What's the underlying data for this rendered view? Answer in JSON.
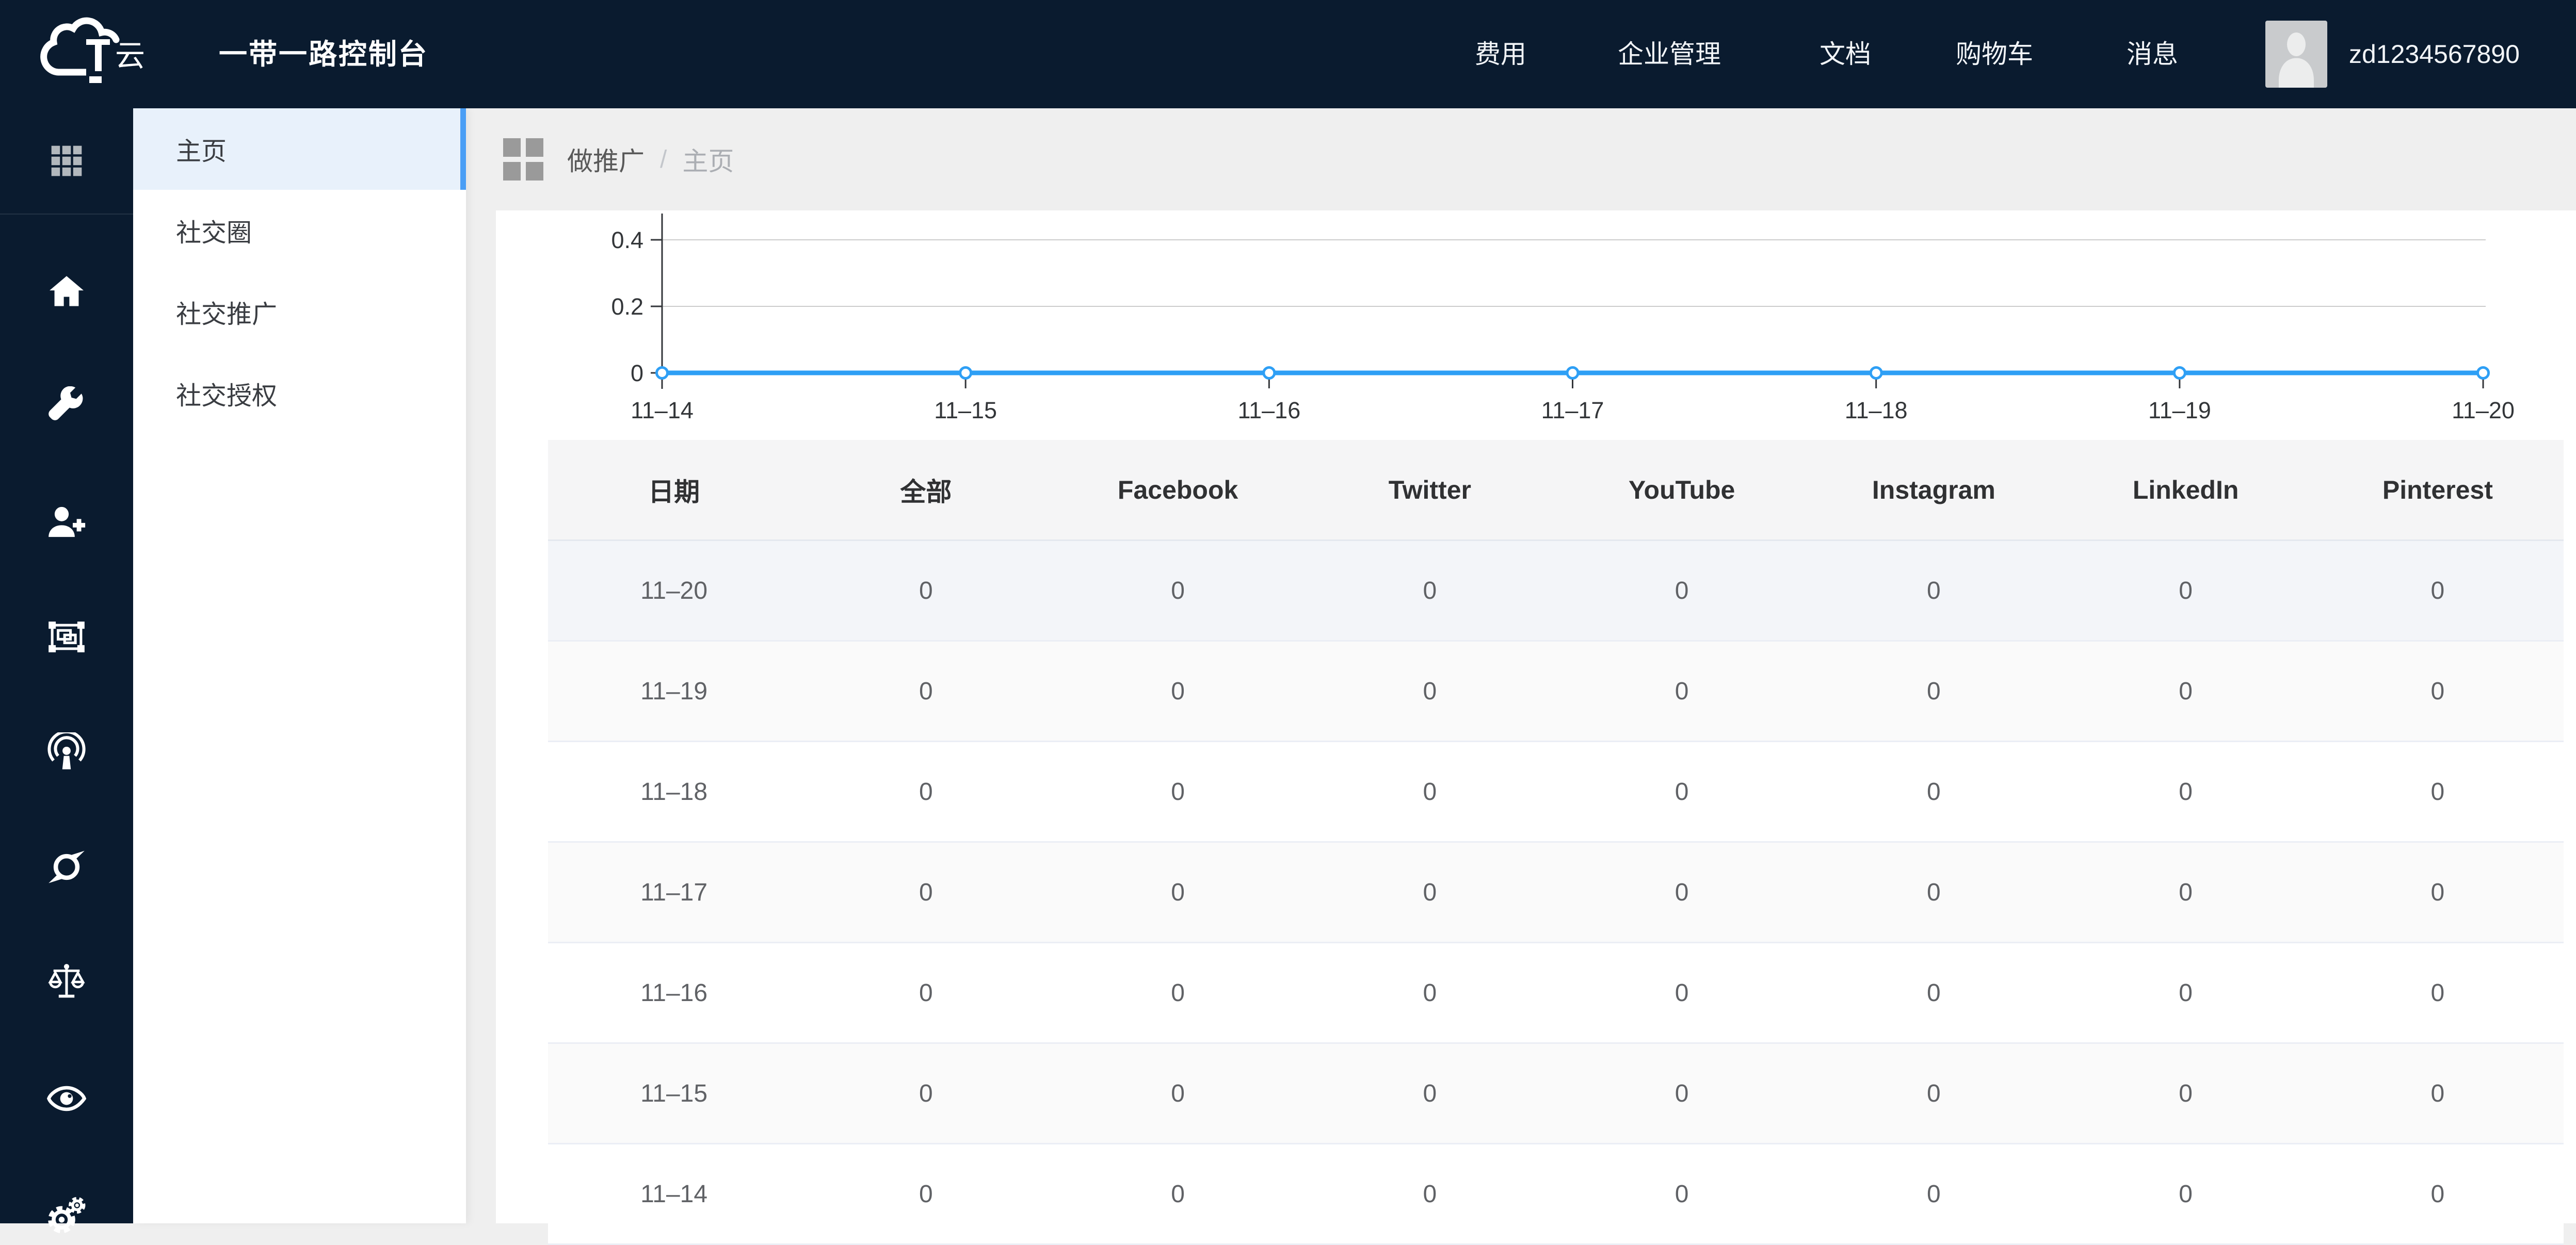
{
  "topbar": {
    "title": "一带一路控制台",
    "logo": {
      "t": "T",
      "yun": "云"
    },
    "nav": [
      {
        "key": "fees",
        "label": "费用"
      },
      {
        "key": "enterprise",
        "label": "企业管理"
      },
      {
        "key": "docs",
        "label": "文档"
      },
      {
        "key": "cart",
        "label": "购物车"
      },
      {
        "key": "messages",
        "label": "消息"
      }
    ],
    "username": "zd1234567890"
  },
  "icon_rail": {
    "top_icon": "grid-menu",
    "icons": [
      "home",
      "wrench",
      "user-plus",
      "object-group",
      "podcast",
      "swirl",
      "balance-scale",
      "eye",
      "gears"
    ]
  },
  "side_menu": {
    "items": [
      {
        "key": "home",
        "label": "主页",
        "active": true
      },
      {
        "key": "social-circle",
        "label": "社交圈",
        "active": false
      },
      {
        "key": "social-promotion",
        "label": "社交推广",
        "active": false
      },
      {
        "key": "social-auth",
        "label": "社交授权",
        "active": false
      }
    ]
  },
  "breadcrumb": {
    "section": "做推广",
    "separator": "/",
    "current": "主页"
  },
  "chart_data": {
    "type": "line",
    "x": [
      "11–14",
      "11–15",
      "11–16",
      "11–17",
      "11–18",
      "11–19",
      "11–20"
    ],
    "series": [
      {
        "name": "全部",
        "values": [
          0,
          0,
          0,
          0,
          0,
          0,
          0
        ],
        "color": "#2e9ff5"
      }
    ],
    "yticks": [
      0,
      0.2,
      0.4
    ],
    "ylim": [
      0,
      0.45
    ],
    "grid": true,
    "marker": "circle-open",
    "title": "",
    "xlabel": "",
    "ylabel": ""
  },
  "table": {
    "headers": [
      "日期",
      "全部",
      "Facebook",
      "Twitter",
      "YouTube",
      "Instagram",
      "LinkedIn",
      "Pinterest"
    ],
    "rows": [
      {
        "cells": [
          "11–20",
          "0",
          "0",
          "0",
          "0",
          "0",
          "0",
          "0"
        ],
        "highlighted": true
      },
      {
        "cells": [
          "11–19",
          "0",
          "0",
          "0",
          "0",
          "0",
          "0",
          "0"
        ],
        "highlighted": false
      },
      {
        "cells": [
          "11–18",
          "0",
          "0",
          "0",
          "0",
          "0",
          "0",
          "0"
        ],
        "highlighted": false
      },
      {
        "cells": [
          "11–17",
          "0",
          "0",
          "0",
          "0",
          "0",
          "0",
          "0"
        ],
        "highlighted": false
      },
      {
        "cells": [
          "11–16",
          "0",
          "0",
          "0",
          "0",
          "0",
          "0",
          "0"
        ],
        "highlighted": false
      },
      {
        "cells": [
          "11–15",
          "0",
          "0",
          "0",
          "0",
          "0",
          "0",
          "0"
        ],
        "highlighted": false
      },
      {
        "cells": [
          "11–14",
          "0",
          "0",
          "0",
          "0",
          "0",
          "0",
          "0"
        ],
        "highlighted": false
      }
    ]
  },
  "colors": {
    "topbar_bg": "#0a1b2f",
    "accent_blue": "#2e9ff5",
    "active_item_bg": "#e8f1fb",
    "active_item_bar": "#4a9ef5",
    "content_bg": "#efefef",
    "stripe_row_bg": "#fafafa",
    "highlight_row_bg": "#f3f5f9",
    "table_border": "#ebeef5",
    "header_text": "#303133",
    "cell_text": "#606266"
  }
}
